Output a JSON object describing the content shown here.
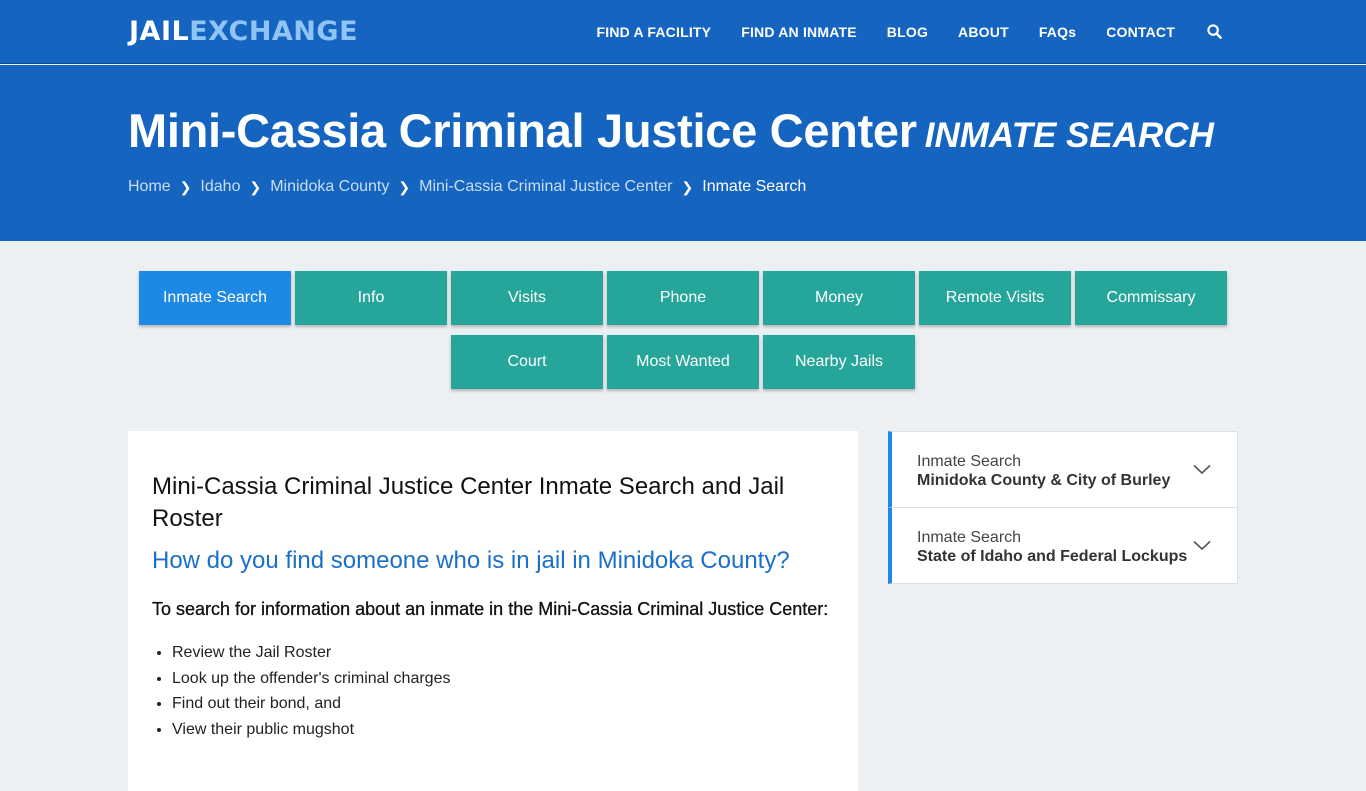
{
  "header": {
    "logo_part1": "JAIL",
    "logo_part2": "EXCHANGE",
    "nav": [
      "FIND A FACILITY",
      "FIND AN INMATE",
      "BLOG",
      "ABOUT",
      "FAQs",
      "CONTACT"
    ],
    "search_icon": "search-icon"
  },
  "hero": {
    "title": "Mini-Cassia Criminal Justice Center",
    "subtitle": "INMATE SEARCH",
    "breadcrumbs": [
      "Home",
      "Idaho",
      "Minidoka County",
      "Mini-Cassia Criminal Justice Center"
    ],
    "breadcrumb_current": "Inmate Search"
  },
  "buttons": {
    "row1": [
      "Inmate Search",
      "Info",
      "Visits",
      "Phone",
      "Money",
      "Remote Visits",
      "Commissary"
    ],
    "row2": [
      "Court",
      "Most Wanted",
      "Nearby Jails"
    ],
    "active": "Inmate Search"
  },
  "main": {
    "heading": "Mini-Cassia Criminal Justice Center Inmate Search and Jail Roster",
    "question": "How do you find someone who is in jail in Minidoka County?",
    "lead": "To search for information about an inmate in the Mini-Cassia Criminal Justice Center:",
    "list": [
      "Review the Jail Roster",
      "Look up the offender's criminal charges",
      "Find out their bond, and",
      "View their public mugshot"
    ]
  },
  "sidebar": {
    "items": [
      {
        "label": "Inmate Search",
        "detail": "Minidoka County & City of Burley"
      },
      {
        "label": "Inmate Search",
        "detail": "State of Idaho and Federal Lockups"
      }
    ]
  },
  "colors": {
    "primary": "#1565c0",
    "teal_button": "#26a69a",
    "active_button": "#1e88e5",
    "question_text": "#1a70c9"
  }
}
